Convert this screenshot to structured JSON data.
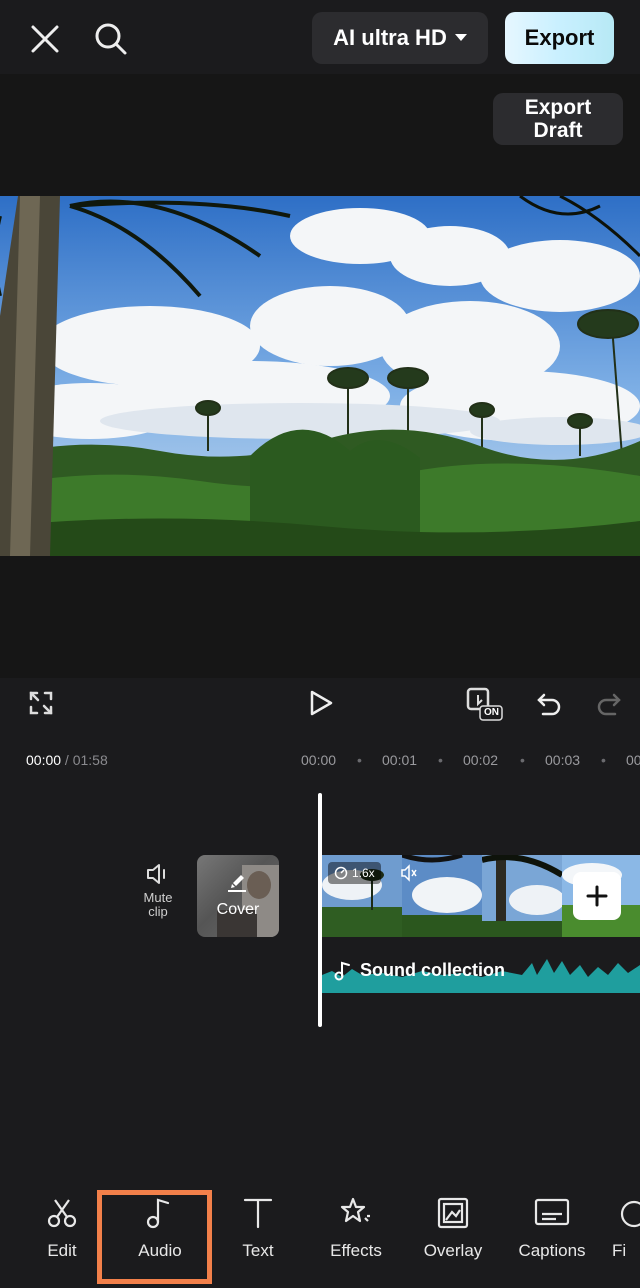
{
  "header": {
    "close_icon": "close-icon",
    "search_icon": "search-icon",
    "quality_label": "AI ultra HD",
    "export_label": "Export",
    "export_draft_label": "Export\nDraft"
  },
  "player": {
    "fullscreen_icon": "fullscreen-icon",
    "play_icon": "play-icon",
    "keyframe_icon": "keyframe-on-icon",
    "keyframe_badge": "ON",
    "undo_icon": "undo-icon",
    "redo_icon": "redo-icon"
  },
  "timeline": {
    "current_time": "00:00",
    "total_time": " / 01:58",
    "ticks": [
      "00:00",
      "00:01",
      "00:02",
      "00:03",
      "00"
    ],
    "mute_label": "Mute\nclip",
    "cover_label": "Cover",
    "speed_label": "1.6x",
    "audio_label": "Sound collection"
  },
  "toolbar": {
    "items": [
      {
        "label": "Edit",
        "icon": "scissors-icon"
      },
      {
        "label": "Audio",
        "icon": "music-note-icon"
      },
      {
        "label": "Text",
        "icon": "text-icon"
      },
      {
        "label": "Effects",
        "icon": "effects-star-icon"
      },
      {
        "label": "Overlay",
        "icon": "overlay-icon"
      },
      {
        "label": "Captions",
        "icon": "captions-icon"
      },
      {
        "label": "Fi",
        "icon": "filters-icon"
      }
    ],
    "selected": "Audio",
    "highlight_color": "#f2804a"
  },
  "colors": {
    "background": "#1b1b1d",
    "audio_wave": "#1f9e9e",
    "export_button": "#d6f3ff"
  }
}
